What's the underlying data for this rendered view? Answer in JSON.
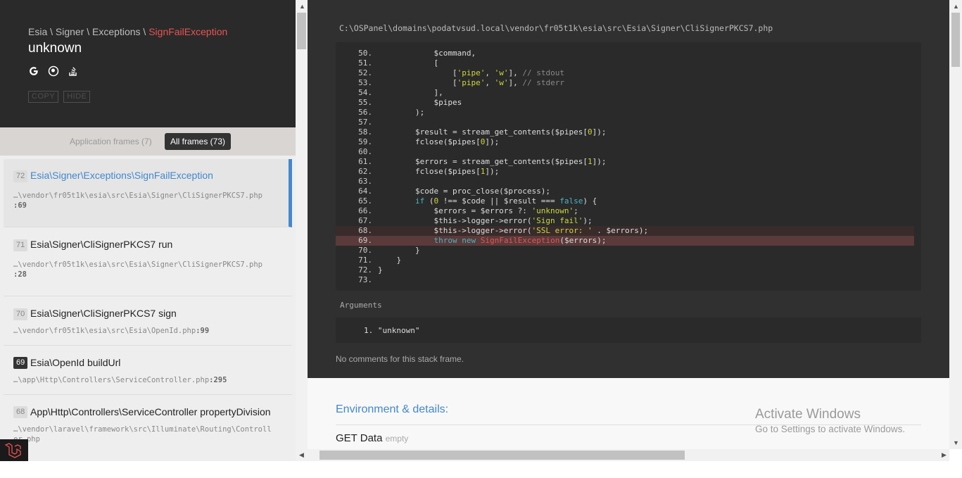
{
  "header": {
    "namespace_parts": [
      "Esia",
      "Signer",
      "Exceptions"
    ],
    "exception_name": "SignFailException",
    "message": "unknown",
    "buttons": {
      "copy": "COPY",
      "hide": "HIDE"
    },
    "search_icons": [
      "google-icon",
      "duckduckgo-icon",
      "stackoverflow-icon"
    ]
  },
  "filters": {
    "application": "Application frames (7)",
    "all": "All frames (73)"
  },
  "frames": [
    {
      "num": "72",
      "title": "Esia\\Signer\\Exceptions\\SignFailException",
      "path": "…\\vendor\\fr05t1k\\esia\\src\\Esia\\Signer\\CliSignerPKCS7.php",
      "line": ":69",
      "active": true
    },
    {
      "num": "71",
      "title": "Esia\\Signer\\CliSignerPKCS7 run",
      "path": "…\\vendor\\fr05t1k\\esia\\src\\Esia\\Signer\\CliSignerPKCS7.php",
      "line": ":28"
    },
    {
      "num": "70",
      "title": "Esia\\Signer\\CliSignerPKCS7 sign",
      "path": "…\\vendor\\fr05t1k\\esia\\src\\Esia\\OpenId.php",
      "line": ":99"
    },
    {
      "num": "69",
      "title": "Esia\\OpenId buildUrl",
      "path": "…\\app\\Http\\Controllers\\ServiceController.php",
      "line": ":295",
      "app": true
    },
    {
      "num": "68",
      "title": "App\\Http\\Controllers\\ServiceController propertyDivision",
      "path": "…\\vendor\\laravel\\framework\\src\\Illuminate\\Routing\\Controller.php",
      "line": ""
    }
  ],
  "code": {
    "file_path": "C:\\OSPanel\\domains\\podatvsud.local\\vendor\\fr05t1k\\esia\\src\\Esia\\Signer\\CliSignerPKCS7.php",
    "lines": [
      {
        "n": "50.",
        "t": "            $command,"
      },
      {
        "n": "51.",
        "t": "            ["
      },
      {
        "n": "52.",
        "t": "                ['pipe', 'w'], // stdout"
      },
      {
        "n": "53.",
        "t": "                ['pipe', 'w'], // stderr"
      },
      {
        "n": "54.",
        "t": "            ],"
      },
      {
        "n": "55.",
        "t": "            $pipes"
      },
      {
        "n": "56.",
        "t": "        );"
      },
      {
        "n": "57.",
        "t": ""
      },
      {
        "n": "58.",
        "t": "        $result = stream_get_contents($pipes[0]);"
      },
      {
        "n": "59.",
        "t": "        fclose($pipes[0]);"
      },
      {
        "n": "60.",
        "t": ""
      },
      {
        "n": "61.",
        "t": "        $errors = stream_get_contents($pipes[1]);"
      },
      {
        "n": "62.",
        "t": "        fclose($pipes[1]);"
      },
      {
        "n": "63.",
        "t": ""
      },
      {
        "n": "64.",
        "t": "        $code = proc_close($process);"
      },
      {
        "n": "65.",
        "t": "        if (0 !== $code || $result === false) {"
      },
      {
        "n": "66.",
        "t": "            $errors = $errors ?: 'unknown';"
      },
      {
        "n": "67.",
        "t": "            $this->logger->error('Sign fail');"
      },
      {
        "n": "68.",
        "t": "            $this->logger->error('SSL error: ' . $errors);"
      },
      {
        "n": "69.",
        "t": "            throw new SignFailException($errors);"
      },
      {
        "n": "70.",
        "t": "        }"
      },
      {
        "n": "71.",
        "t": "    }"
      },
      {
        "n": "72.",
        "t": "}"
      },
      {
        "n": "73.",
        "t": ""
      }
    ],
    "highlight_line": "69."
  },
  "arguments": {
    "label": "Arguments",
    "items": [
      "1.  \"unknown\""
    ]
  },
  "no_comments": "No comments for this stack frame.",
  "environment": {
    "title": "Environment & details:",
    "get_data_label": "GET Data",
    "get_data_value": "empty"
  },
  "watermark": {
    "title": "Activate Windows",
    "subtitle": "Go to Settings to activate Windows."
  },
  "colors": {
    "accent": "#4288ce",
    "exception": "#e95353",
    "code_bg": "#2a2a2a",
    "panel_bg": "#303030"
  }
}
